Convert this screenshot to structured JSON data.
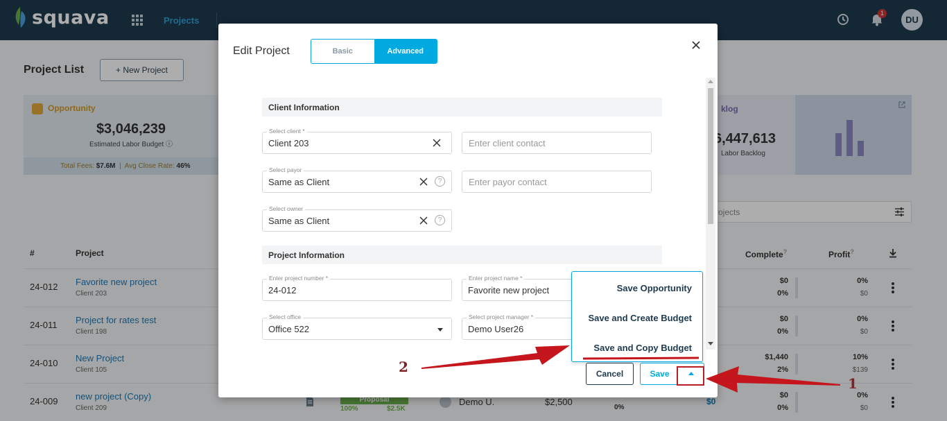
{
  "nav": {
    "logo": "squava",
    "projects": "Projects",
    "notifications_count": "1",
    "avatar": "DU"
  },
  "page": {
    "title": "Project List",
    "new_project": "+ New Project"
  },
  "opportunity_card": {
    "label": "Opportunity",
    "value": "$3,046,239",
    "sub": "Estimated Labor Budget",
    "total_fees_label": "Total Fees:",
    "total_fees": "$7.6M",
    "close_rate_label": "Avg Close Rate:",
    "close_rate": "46%"
  },
  "backlog_card": {
    "label": "klog",
    "value": "6,447,613",
    "sub": "Labor Backlog"
  },
  "search": {
    "placeholder": "rojects"
  },
  "table": {
    "headers": {
      "num": "#",
      "project": "Project",
      "complete": "Complete",
      "profit": "Profit",
      "help": "?"
    },
    "rows": [
      {
        "num": "24-012",
        "name": "Favorite new project",
        "client": "Client 203",
        "complete_amt": "$0",
        "complete_pct": "0%",
        "profit_pct": "0%",
        "profit_amt": "$0"
      },
      {
        "num": "24-011",
        "name": "Project for rates test",
        "client": "Client 198",
        "complete_amt": "$0",
        "complete_pct": "0%",
        "profit_pct": "0%",
        "profit_amt": "$0"
      },
      {
        "num": "24-010",
        "name": "New Project",
        "client": "Client 105",
        "complete_amt": "$1,440",
        "complete_pct": "2%",
        "profit_pct": "10%",
        "profit_amt": "$139"
      },
      {
        "num": "24-009",
        "name": "new project (Copy)",
        "client": "Client 209",
        "complete_amt": "$0",
        "complete_pct": "0%",
        "profit_pct": "0%",
        "profit_amt": "$0"
      }
    ],
    "last_row_extra": {
      "stage": "Proposal",
      "stage_pct": "100%",
      "stage_amt": "$2.5K",
      "owner": "Demo U.",
      "budget": "$2,500",
      "pct": "0%",
      "fee": "$0"
    }
  },
  "modal": {
    "title": "Edit Project",
    "tab_basic": "Basic",
    "tab_advanced": "Advanced",
    "client_section": "Client Information",
    "project_section": "Project Information",
    "client": {
      "label": "Select client *",
      "value": "Client 203"
    },
    "client_contact": {
      "placeholder": "Enter client contact"
    },
    "payor": {
      "label": "Select payor",
      "value": "Same as Client"
    },
    "payor_contact": {
      "placeholder": "Enter payor contact"
    },
    "owner": {
      "label": "Select owner",
      "value": "Same as Client"
    },
    "project_number": {
      "label": "Enter project number *",
      "value": "24-012"
    },
    "project_name": {
      "label": "Enter project name *",
      "value": "Favorite new project"
    },
    "office": {
      "label": "Select office",
      "value": "Office 522"
    },
    "project_manager": {
      "label": "Select project manager *",
      "value": "Demo User26"
    },
    "help": "?",
    "cancel": "Cancel",
    "save": "Save",
    "save_menu": [
      "Save Opportunity",
      "Save and Create Budget",
      "Save and Copy Budget"
    ]
  },
  "annotations": {
    "step1": "1",
    "step2": "2"
  },
  "colors": {
    "nav_bg": "#1e3a4f",
    "accent": "#00a9e0",
    "annotation_red": "#c4161c"
  }
}
